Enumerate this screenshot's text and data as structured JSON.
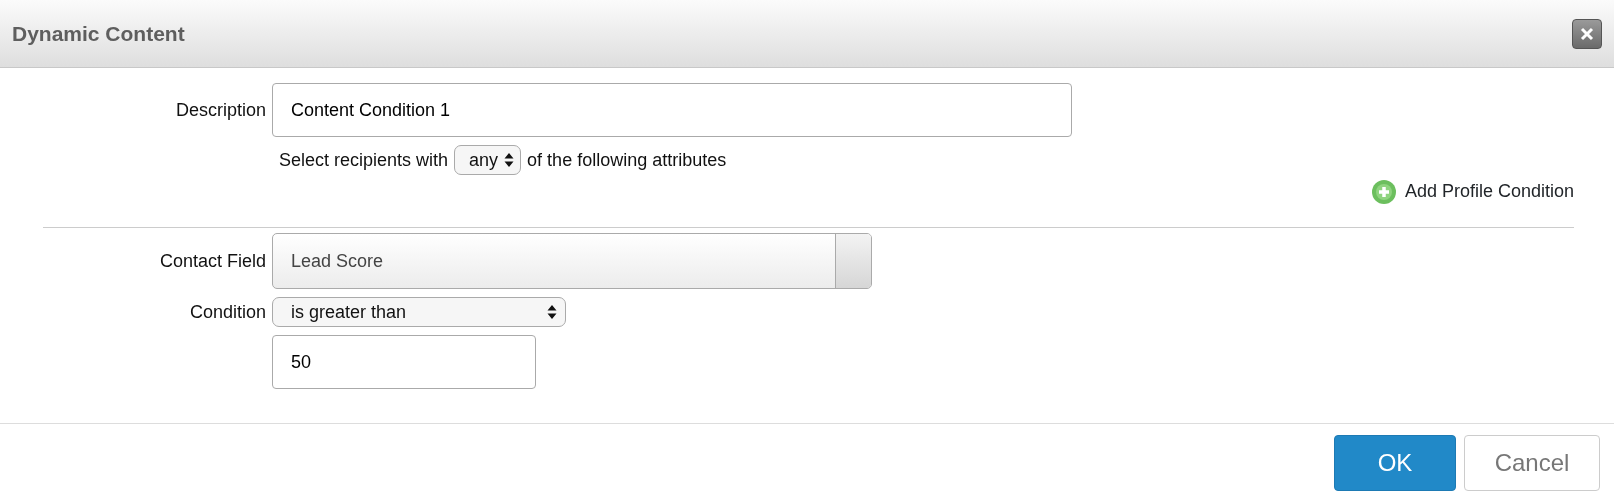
{
  "window": {
    "title": "Dynamic Content"
  },
  "description": {
    "label": "Description",
    "value": "Content Condition 1"
  },
  "match": {
    "prefix": "Select recipients with",
    "value": "any",
    "suffix": "of the following attributes"
  },
  "add_condition": {
    "label": "Add Profile Condition"
  },
  "conditions": [
    {
      "kind": "picker",
      "label": "Contact Field",
      "value": "Lead Score"
    },
    {
      "kind": "select",
      "label": "Condition",
      "value": "is greater than"
    },
    {
      "kind": "input",
      "value": "50"
    }
  ],
  "buttons": [
    {
      "label": "OK",
      "primary": true
    },
    {
      "label": "Cancel",
      "primary": false
    }
  ]
}
